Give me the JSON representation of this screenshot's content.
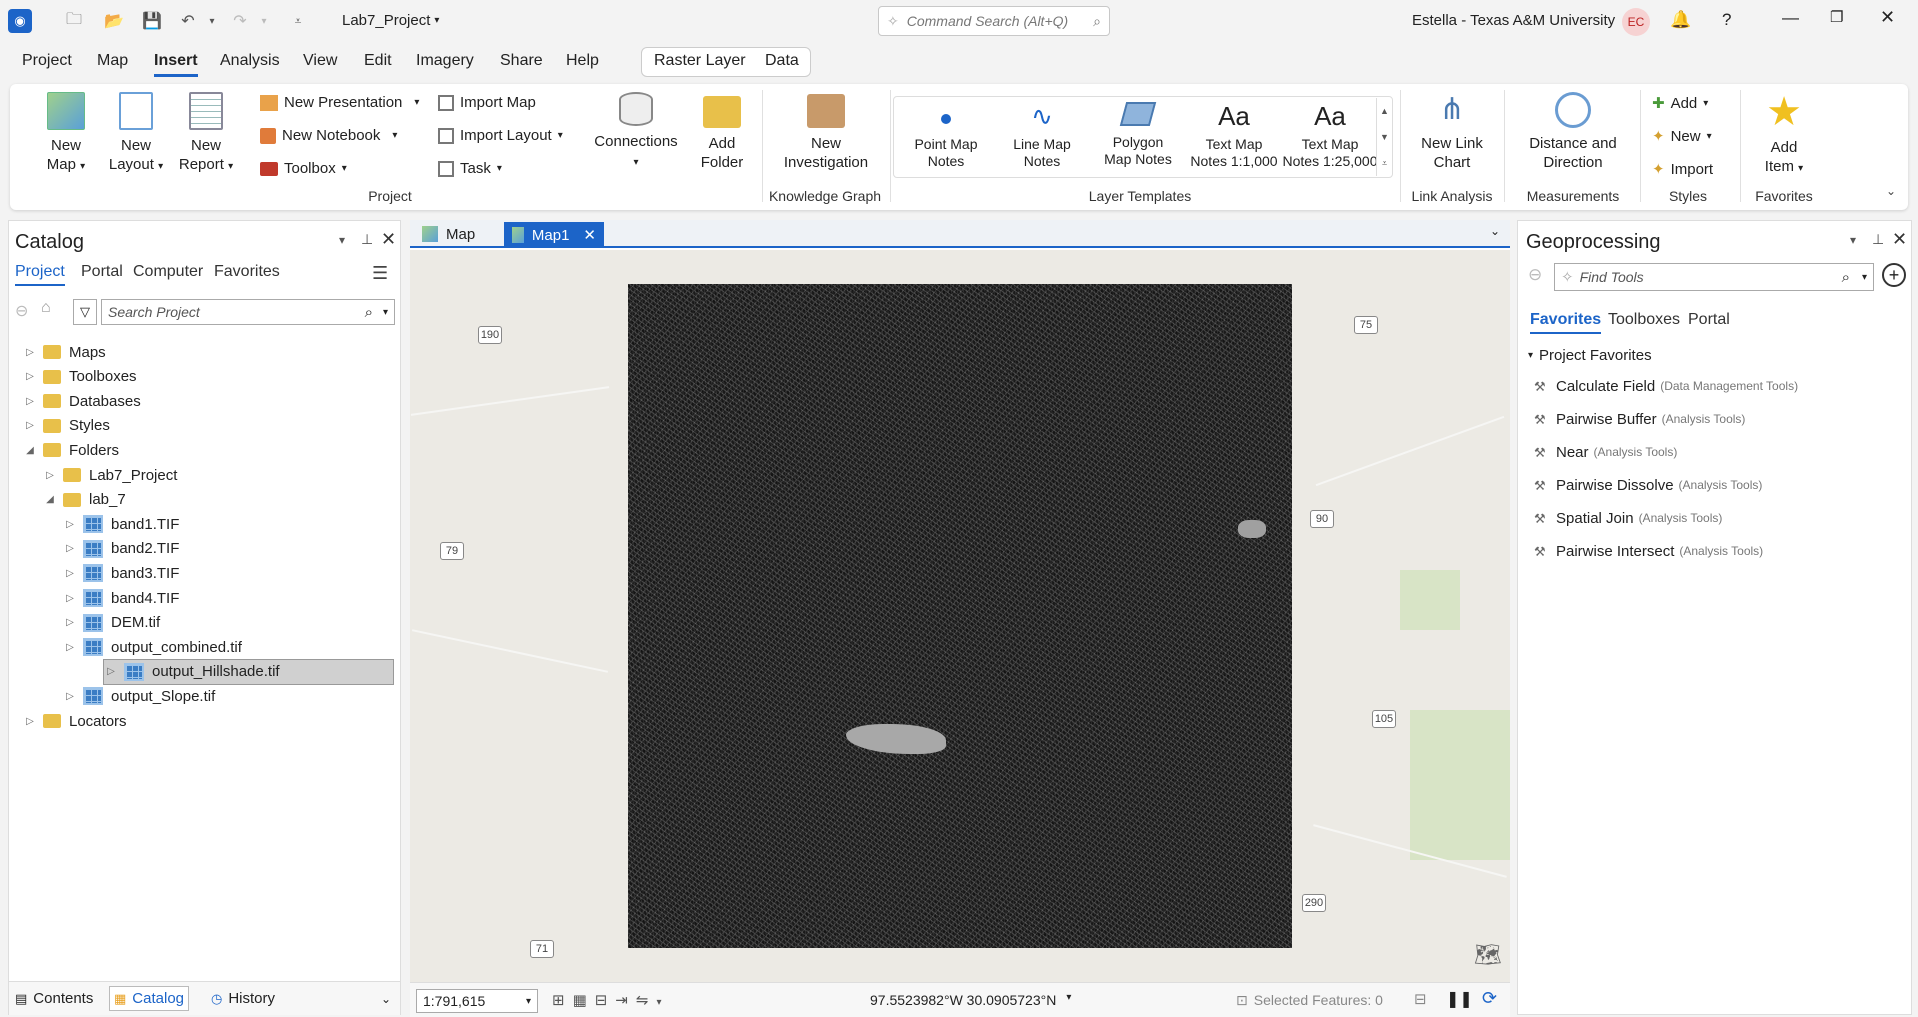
{
  "titlebar": {
    "project_title": "Lab7_Project",
    "command_search_placeholder": "Command Search (Alt+Q)",
    "user": "Estella - Texas A&M University",
    "user_initials": "EC"
  },
  "menu": {
    "items": [
      "Project",
      "Map",
      "Insert",
      "Analysis",
      "View",
      "Edit",
      "Imagery",
      "Share",
      "Help"
    ],
    "active": "Insert",
    "context_tabs": [
      "Raster Layer",
      "Data"
    ]
  },
  "ribbon": {
    "project": {
      "new_map": "New\nMap",
      "new_layout": "New\nLayout",
      "new_report": "New\nReport",
      "new_presentation": "New Presentation",
      "new_notebook": "New Notebook",
      "toolbox": "Toolbox",
      "import_map": "Import Map",
      "import_layout": "Import Layout",
      "task": "Task",
      "connections": "Connections",
      "add_folder": "Add\nFolder",
      "group": "Project"
    },
    "knowledge_graph": {
      "new_investigation": "New\nInvestigation",
      "group": "Knowledge Graph"
    },
    "layer_templates": {
      "items": [
        "Point Map\nNotes",
        "Line Map\nNotes",
        "Polygon\nMap Notes",
        "Text Map\nNotes 1:1,000",
        "Text Map\nNotes 1:25,000"
      ],
      "group": "Layer Templates"
    },
    "link_analysis": {
      "new_link_chart": "New Link\nChart",
      "group": "Link Analysis"
    },
    "measurements": {
      "distance": "Distance and\nDirection",
      "group": "Measurements"
    },
    "styles": {
      "add": "Add",
      "new": "New",
      "import": "Import",
      "group": "Styles"
    },
    "favorites": {
      "add_item": "Add\nItem",
      "group": "Favorites"
    }
  },
  "catalog": {
    "title": "Catalog",
    "tabs": [
      "Project",
      "Portal",
      "Computer",
      "Favorites"
    ],
    "search_placeholder": "Search Project",
    "tree": [
      {
        "label": "Maps",
        "level": 0,
        "state": "collapsed",
        "icon": "folder"
      },
      {
        "label": "Toolboxes",
        "level": 0,
        "state": "collapsed",
        "icon": "folder"
      },
      {
        "label": "Databases",
        "level": 0,
        "state": "collapsed",
        "icon": "folder"
      },
      {
        "label": "Styles",
        "level": 0,
        "state": "collapsed",
        "icon": "folder"
      },
      {
        "label": "Folders",
        "level": 0,
        "state": "expanded",
        "icon": "folder"
      },
      {
        "label": "Lab7_Project",
        "level": 1,
        "state": "collapsed",
        "icon": "folder"
      },
      {
        "label": "lab_7",
        "level": 1,
        "state": "expanded",
        "icon": "folder"
      },
      {
        "label": "band1.TIF",
        "level": 2,
        "state": "collapsed",
        "icon": "raster"
      },
      {
        "label": "band2.TIF",
        "level": 2,
        "state": "collapsed",
        "icon": "raster"
      },
      {
        "label": "band3.TIF",
        "level": 2,
        "state": "collapsed",
        "icon": "raster"
      },
      {
        "label": "band4.TIF",
        "level": 2,
        "state": "collapsed",
        "icon": "raster"
      },
      {
        "label": "DEM.tif",
        "level": 2,
        "state": "collapsed",
        "icon": "raster"
      },
      {
        "label": "output_combined.tif",
        "level": 2,
        "state": "collapsed",
        "icon": "raster"
      },
      {
        "label": "output_Hillshade.tif",
        "level": 2,
        "state": "collapsed",
        "icon": "raster",
        "selected": true
      },
      {
        "label": "output_Slope.tif",
        "level": 2,
        "state": "collapsed",
        "icon": "raster"
      },
      {
        "label": "Locators",
        "level": 0,
        "state": "collapsed",
        "icon": "folder"
      }
    ],
    "bottom_tabs": [
      "Contents",
      "Catalog",
      "History"
    ]
  },
  "map": {
    "tabs": [
      "Map",
      "Map1"
    ],
    "active_tab": "Map1",
    "scale": "1:791,615",
    "coords": "97.5523982°W 30.0905723°N",
    "selected_features": "Selected Features: 0",
    "road_labels": [
      "190",
      "79",
      "75",
      "90",
      "105",
      "290",
      "71"
    ]
  },
  "geoprocessing": {
    "title": "Geoprocessing",
    "search_placeholder": "Find Tools",
    "tabs": [
      "Favorites",
      "Toolboxes",
      "Portal"
    ],
    "section": "Project Favorites",
    "tools": [
      {
        "name": "Calculate Field",
        "toolbox": "(Data Management Tools)"
      },
      {
        "name": "Pairwise Buffer",
        "toolbox": "(Analysis Tools)"
      },
      {
        "name": "Near",
        "toolbox": "(Analysis Tools)"
      },
      {
        "name": "Pairwise Dissolve",
        "toolbox": "(Analysis Tools)"
      },
      {
        "name": "Spatial Join",
        "toolbox": "(Analysis Tools)"
      },
      {
        "name": "Pairwise Intersect",
        "toolbox": "(Analysis Tools)"
      }
    ]
  }
}
